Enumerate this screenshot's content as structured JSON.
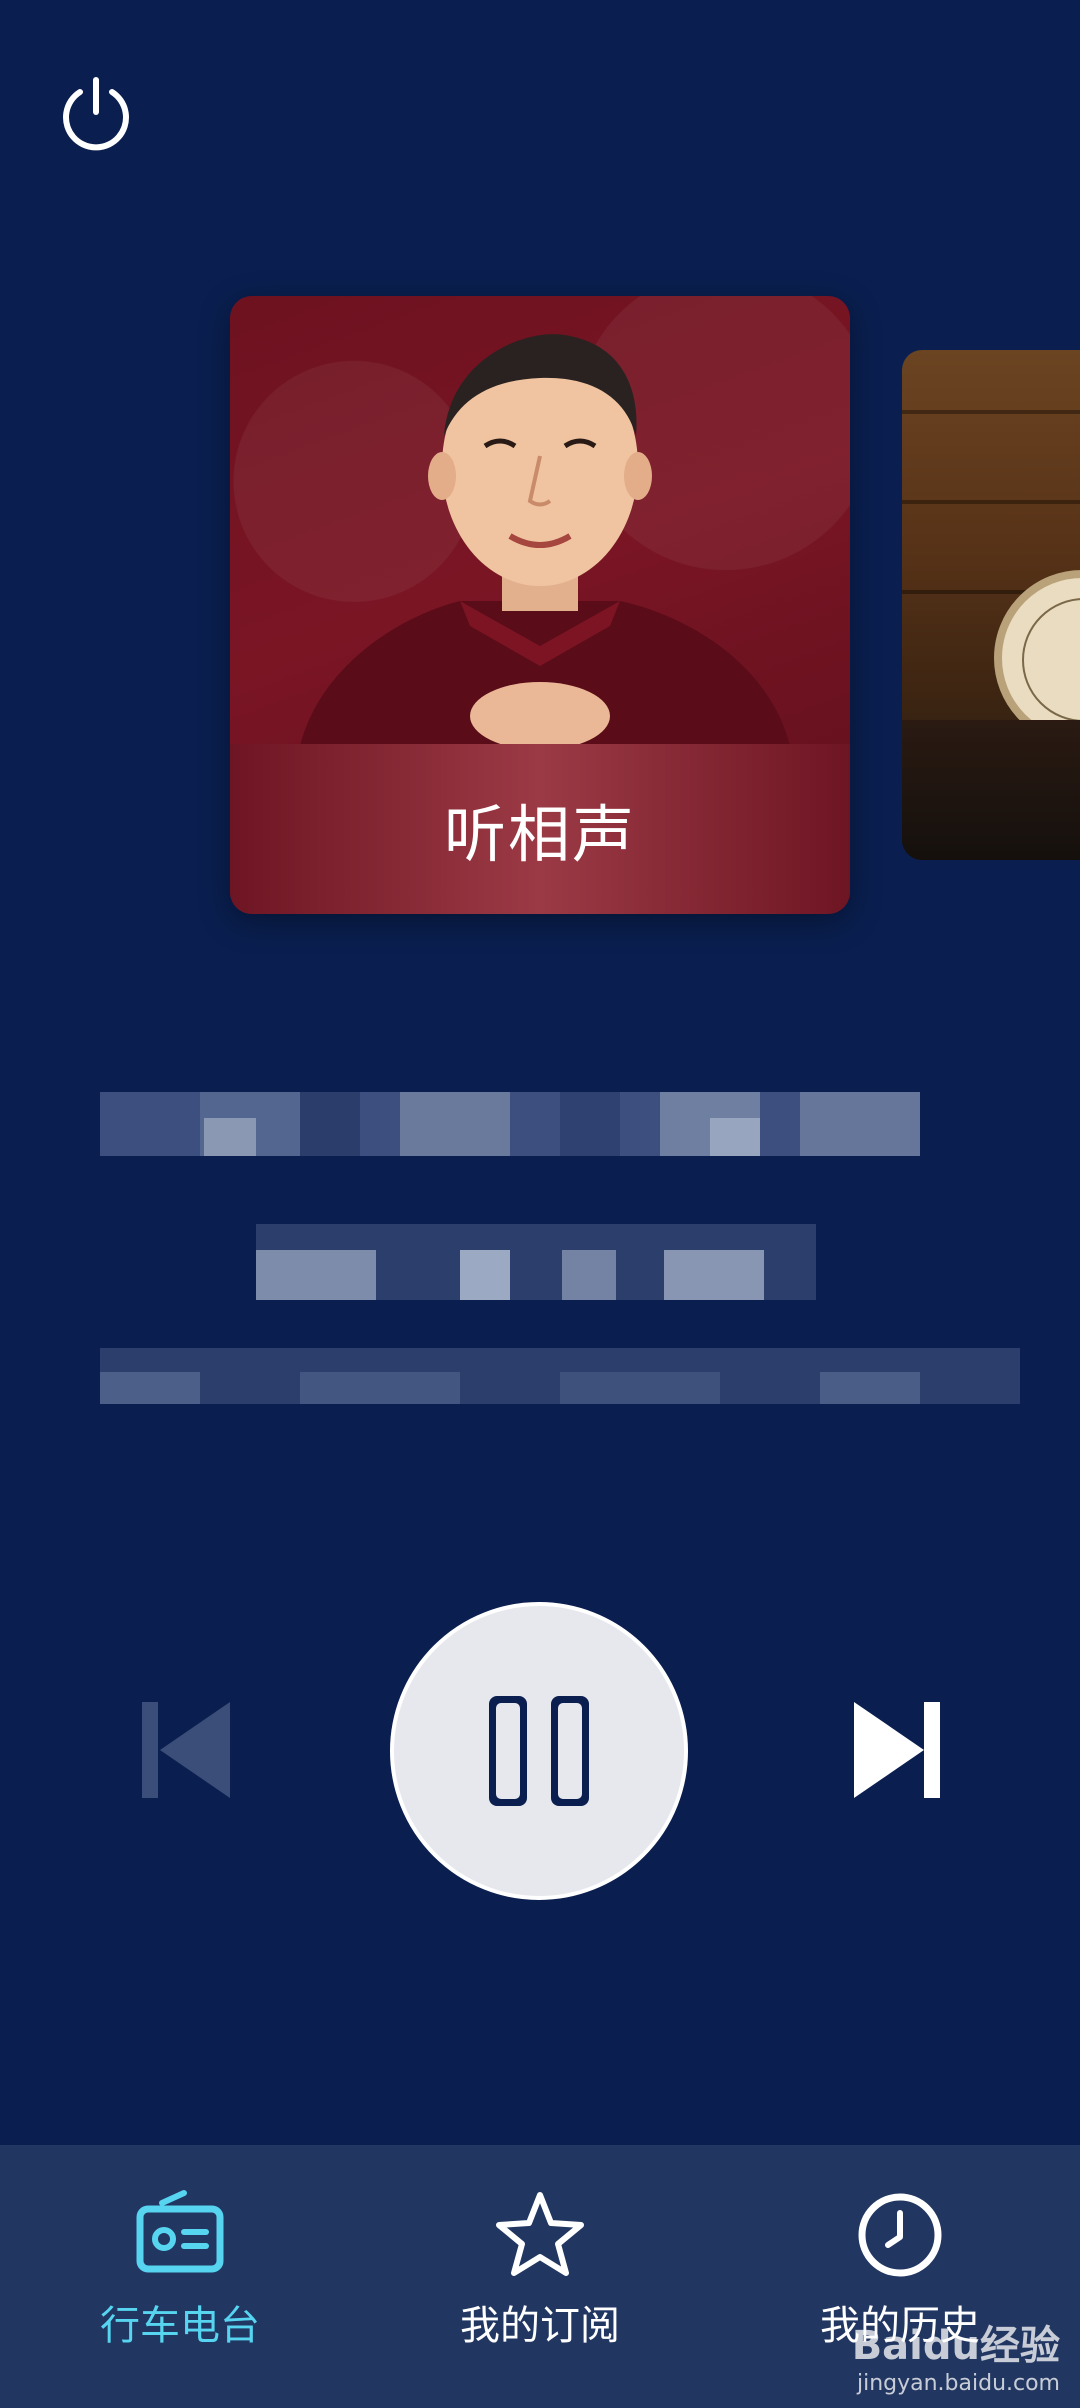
{
  "topbar": {
    "power_icon": "power-icon"
  },
  "carousel": {
    "main_card": {
      "title": "听相声"
    },
    "side_card": {
      "title": ""
    }
  },
  "player": {
    "prev_icon": "skip-previous-icon",
    "play_pause_icon": "pause-icon",
    "next_icon": "skip-next-icon"
  },
  "tabbar": {
    "tabs": [
      {
        "label": "行车电台",
        "icon": "radio-icon",
        "active": true
      },
      {
        "label": "我的订阅",
        "icon": "star-icon",
        "active": false
      },
      {
        "label": "我的历史",
        "icon": "clock-icon",
        "active": false
      }
    ]
  },
  "colors": {
    "background": "#0a1f4f",
    "tabbar": "#213661",
    "accent": "#56d4f0",
    "card_red": "#7a1524"
  },
  "watermark": {
    "logo": "Baidu经验",
    "url": "jingyan.baidu.com"
  }
}
